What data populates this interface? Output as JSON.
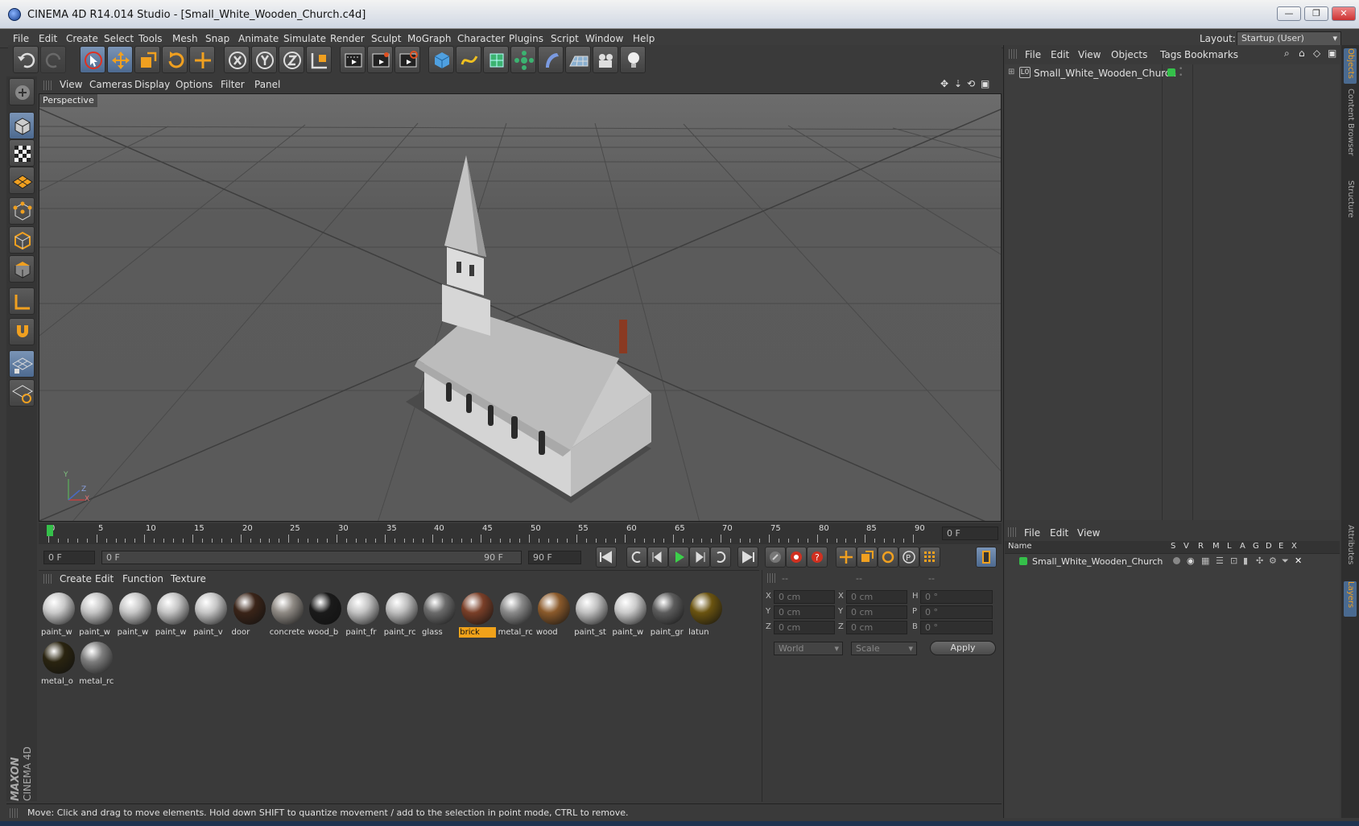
{
  "window": {
    "title": "CINEMA 4D R14.014 Studio - [Small_White_Wooden_Church.c4d]",
    "controls": [
      "—",
      "❐",
      "✕"
    ]
  },
  "menubar": {
    "items": [
      "File",
      "Edit",
      "Create",
      "Select",
      "Tools",
      "Mesh",
      "Snap",
      "Animate",
      "Simulate",
      "Render",
      "Sculpt",
      "MoGraph",
      "Character",
      "Plugins",
      "Script",
      "Window",
      "Help"
    ],
    "layout_label": "Layout:",
    "layout_value": "Startup (User)"
  },
  "viewport": {
    "menu": [
      "View",
      "Cameras",
      "Display",
      "Options",
      "Filter",
      "Panel"
    ],
    "label": "Perspective",
    "axis": {
      "y": "Y",
      "z": "Z",
      "x": "X"
    }
  },
  "timeline": {
    "ticks": [
      "0",
      "5",
      "10",
      "15",
      "20",
      "25",
      "30",
      "35",
      "40",
      "45",
      "50",
      "55",
      "60",
      "65",
      "70",
      "75",
      "80",
      "85",
      "90"
    ],
    "current_frame": "0 F"
  },
  "transport": {
    "start_field": "0 F",
    "range_start": "0 F",
    "range_end": "90 F",
    "end_field": "90 F"
  },
  "materials": {
    "menu": [
      "Create",
      "Edit",
      "Function",
      "Texture"
    ],
    "items": [
      {
        "label": "paint_w",
        "color": "#c9c9c9"
      },
      {
        "label": "paint_w",
        "color": "#c4c4c4"
      },
      {
        "label": "paint_w",
        "color": "#c6c6c6"
      },
      {
        "label": "paint_w",
        "color": "#c3c3c3"
      },
      {
        "label": "paint_v",
        "color": "#c5c5c5"
      },
      {
        "label": "door",
        "color": "#3a2418"
      },
      {
        "label": "concrete",
        "color": "#8f8a84"
      },
      {
        "label": "wood_b",
        "color": "#1a1a1a"
      },
      {
        "label": "paint_fr",
        "color": "#c2c2c2"
      },
      {
        "label": "paint_rc",
        "color": "#bdbdbd"
      },
      {
        "label": "glass",
        "color": "#6b6b6b"
      },
      {
        "label": "brick",
        "color": "#7a3f28"
      },
      {
        "label": "metal_rc",
        "color": "#8a8a8a"
      },
      {
        "label": "wood",
        "color": "#8b5a2b"
      },
      {
        "label": "paint_st",
        "color": "#c0c0c0"
      },
      {
        "label": "paint_w",
        "color": "#cacaca"
      },
      {
        "label": "paint_gr",
        "color": "#5c5c5c"
      },
      {
        "label": "latun",
        "color": "#6b5410"
      },
      {
        "label": "metal_o",
        "color": "#2a2410"
      },
      {
        "label": "metal_rc",
        "color": "#7d7d7d"
      }
    ],
    "selected_index": 11
  },
  "coords": {
    "headers": [
      "--",
      "--",
      "--"
    ],
    "rows": [
      {
        "a": "X",
        "av": "0 cm",
        "b": "X",
        "bv": "0 cm",
        "c": "H",
        "cv": "0 °"
      },
      {
        "a": "Y",
        "av": "0 cm",
        "b": "Y",
        "bv": "0 cm",
        "c": "P",
        "cv": "0 °"
      },
      {
        "a": "Z",
        "av": "0 cm",
        "b": "Z",
        "bv": "0 cm",
        "c": "B",
        "cv": "0 °"
      }
    ],
    "space": "World",
    "mode": "Scale",
    "apply": "Apply"
  },
  "objects": {
    "menu": [
      "File",
      "Edit",
      "View",
      "Objects",
      "Tags",
      "Bookmarks"
    ],
    "tree": [
      {
        "name": "Small_White_Wooden_Church"
      }
    ]
  },
  "layers": {
    "menu": [
      "File",
      "Edit",
      "View"
    ],
    "columns": [
      "Name",
      "S",
      "V",
      "R",
      "M",
      "L",
      "A",
      "G",
      "D",
      "E",
      "X"
    ],
    "rows": [
      {
        "name": "Small_White_Wooden_Church"
      }
    ]
  },
  "sidetabs": [
    "Objects",
    "Content Browser",
    "Structure",
    "Attributes",
    "Layers"
  ],
  "brand": {
    "line1": "MAXON",
    "line2": "CINEMA 4D"
  },
  "status": "Move: Click and drag to move elements. Hold down SHIFT to quantize movement / add to the selection in point mode, CTRL to remove."
}
